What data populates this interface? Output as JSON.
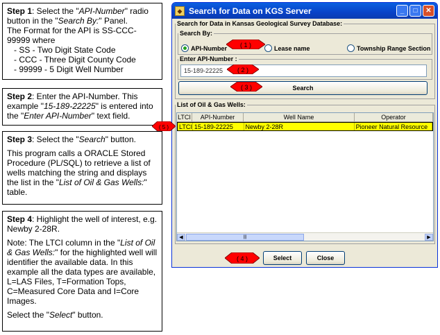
{
  "notes": {
    "step1": {
      "heading": "Step 1",
      "line1_prefix": ": Select the \"",
      "line1_em": "API-Number",
      "line1_suffix": "\" radio button in the \"",
      "line1_em2": "Search By:",
      "line1_end": "\" Panel.",
      "line2": "The Format for the API is SS-CCC-99999 where",
      "bullets": [
        "- SS -  Two Digit State Code",
        "- CCC -  Three Digit County Code",
        "- 99999 - 5 Digit Well Number"
      ]
    },
    "step2": {
      "heading": "Step 2",
      "pre": ": Enter the API-Number. This example \"",
      "em": "15-189-22225",
      "mid": "\" is entered into the \"",
      "em2": "Enter API-Number",
      "end": "\" text field."
    },
    "step3": {
      "heading": "Step 3",
      "pre": ": Select the \"",
      "em": "Search",
      "end": "\" button.",
      "para_pre": "This program calls a ORACLE Stored Procedure (PL/SQL) to retrieve a list of wells matching the string and displays the list in the \"",
      "para_em": "List of Oil & Gas Wells:",
      "para_end": "\" table."
    },
    "step4": {
      "heading": "Step 4",
      "line1": ": Highlight the well of interest, e.g. Newby 2-28R.",
      "para_pre": "Note: The LTCI column in the \"",
      "para_em": "List of Oil & Gas Wells:",
      "para_end": "\" for the highlighted well will identifier the available data. In this example all the data types are available, L=LAS Files, T=Formation Tops, C=Measured Core Data and I=Core Images.",
      "last_pre": "Select the \"",
      "last_em": "Select",
      "last_end": "\" button."
    }
  },
  "window": {
    "title": "Search for Data on KGS Server",
    "group_title": "Search for Data in Kansas Geological Survey Database:",
    "search_by_label": "Search By:",
    "radios": [
      "API-Number",
      "Lease name",
      "Township Range Section"
    ],
    "enter_api_label": "Enter API-Number :",
    "api_value": "15-189-22225",
    "search_button": "Search",
    "list_title": "List of Oil & Gas Wells:",
    "columns": [
      "LTCI",
      "API-Number",
      "Well Name",
      "Operator"
    ],
    "rows": [
      {
        "ltci": "LTCI",
        "api": "15-189-22225",
        "name": "Newby 2-28R",
        "operator": "Pioneer Natural Resource"
      }
    ],
    "scroll_thumb": "|||",
    "select_button": "Select",
    "close_button": "Close"
  },
  "markers": [
    "( 1 )",
    "( 2 )",
    "( 3 )",
    "( 4 )",
    "( 5 )"
  ],
  "colors": {
    "marker": "#ff0000",
    "highlight": "#ffff00",
    "titlebar": "#0842c8"
  }
}
